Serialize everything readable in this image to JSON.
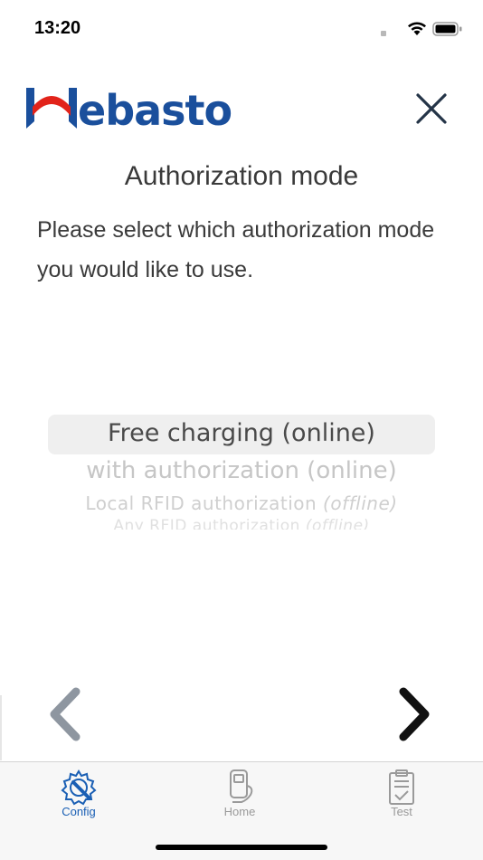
{
  "status_bar": {
    "time": "13:20",
    "icons": [
      "signal-dot",
      "wifi-icon",
      "battery-icon"
    ]
  },
  "header": {
    "logo_text": "Webasto",
    "close_icon": "close-icon"
  },
  "page": {
    "title": "Authorization mode",
    "description": "Please select which authorization mode you would like to use."
  },
  "picker": {
    "selected_index": 0,
    "options": [
      {
        "label": "Free charging (online)",
        "suffix": ""
      },
      {
        "label": "with authorization (online)",
        "suffix": ""
      },
      {
        "label": "Local RFID authorization ",
        "suffix": "(offline)"
      },
      {
        "label": "Any RFID authorization ",
        "suffix": "(offline)"
      }
    ]
  },
  "navigation": {
    "back_icon": "chevron-left-icon",
    "next_icon": "chevron-right-icon"
  },
  "tab_bar": {
    "tabs": [
      {
        "label": "Config",
        "icon": "config-gear-wrench-icon",
        "active": true
      },
      {
        "label": "Home",
        "icon": "charger-icon",
        "active": false
      },
      {
        "label": "Test",
        "icon": "clipboard-check-icon",
        "active": false
      }
    ]
  },
  "colors": {
    "brand_blue": "#1a4f9c",
    "brand_red": "#e2231a",
    "active_tab": "#1a5fb4",
    "inactive_tab": "#9a9a9a",
    "back_disabled": "#8e96a0",
    "next_enabled": "#111111"
  }
}
